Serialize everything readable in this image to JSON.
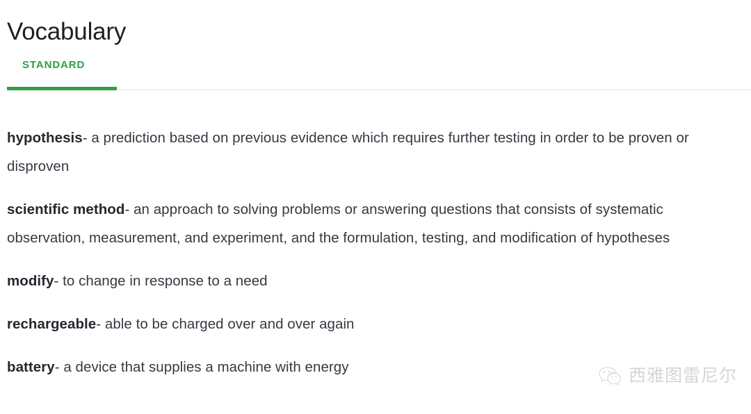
{
  "header": {
    "title": "Vocabulary"
  },
  "tabs": {
    "items": [
      {
        "label": "STANDARD",
        "active": true
      }
    ],
    "active_color": "#2f9e44",
    "rule_color": "#e3e6e8"
  },
  "vocabulary": {
    "separator": "-",
    "entries": [
      {
        "term": "hypothesis",
        "definition": "a prediction based on previous evidence which requires further testing in order to be proven or disproven"
      },
      {
        "term": "scientific method",
        "definition": "an approach to solving problems or answering questions that consists of systematic observation, measurement, and experiment, and the formulation, testing, and modification of hypotheses"
      },
      {
        "term": "modify",
        "definition": "to change in response to a need"
      },
      {
        "term": "rechargeable",
        "definition": "able to be charged over and over again"
      },
      {
        "term": "battery",
        "definition": "a device that supplies a machine with energy"
      }
    ]
  },
  "watermark": {
    "icon": "wechat-icon",
    "text": "西雅图雷尼尔",
    "color": "#b9bdc2"
  }
}
